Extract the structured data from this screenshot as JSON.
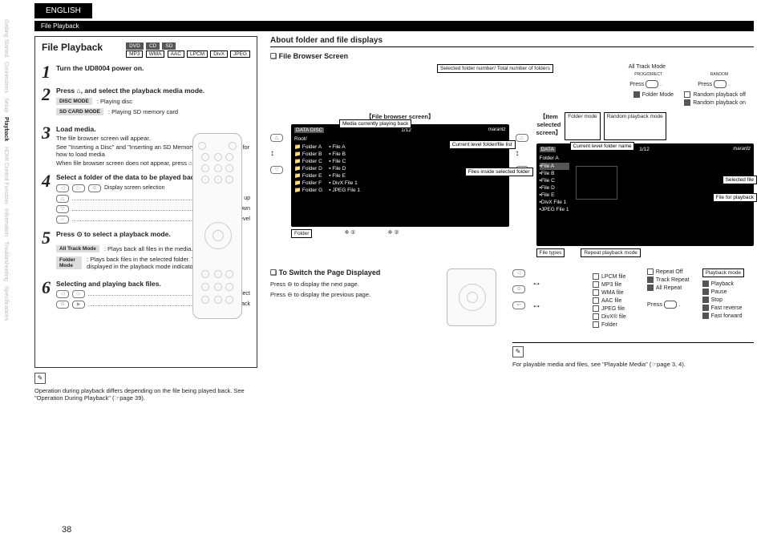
{
  "language_tab": "ENGLISH",
  "section_header": "File Playback",
  "sidenav": [
    "Getting Started",
    "Connections",
    "Setup",
    "Playback",
    "HDMI Control Function",
    "Information",
    "Troubleshooting",
    "Specifications"
  ],
  "sidenav_active": 3,
  "left": {
    "title": "File Playback",
    "badges_dark": [
      "DVD",
      "CD",
      "SD"
    ],
    "badges_light": [
      "MP3",
      "WMA",
      "AAC",
      "LPCM",
      "DivX",
      "JPEG"
    ],
    "step1_title": "Turn the UD8004 power on.",
    "step2_title": "Press ⌂, and select the playback media mode.",
    "disc_mode_label": "DISC MODE",
    "disc_mode_text": ": Playing disc",
    "sd_mode_label": "SD CARD MODE",
    "sd_mode_text": ": Playing SD memory card",
    "step3_title": "Load media.",
    "step3_a": "The file browser screen will appear.",
    "step3_b": "See \"Inserting a Disc\" and \"Inserting an SD Memory Card\" (☞page 6) for how to load media",
    "step3_c": "When file browser screen does not appear, press ⌂.",
    "step4_title": "Select a folder of the data to be played back and press ⊙.",
    "step4_legend0": "Display screen selection",
    "step4_legend1": "To next level up",
    "step4_legend2": "To next level down",
    "step4_legend3": "To the top level",
    "step5_title": "Press ⊙ to select a playback mode.",
    "alltrack_label": "All Track Mode",
    "alltrack_text": ": Plays back all files in the media.",
    "folder_label": "Folder Mode",
    "folder_text": ": Plays back files in the selected folder. The folder icon is displayed in the playback mode indicator.",
    "step6_title": "Selecting and playing back files.",
    "step6_legend1": "Select",
    "step6_legend2": "Decision or playback",
    "footnote": "Operation during playback differs depending on the file being played back. See \"Operation During Playback\" (☞page 39)."
  },
  "right": {
    "h3": "About folder and file displays",
    "h4a": "❏ File Browser Screen",
    "alltrack_mode": "All Track Mode",
    "prog_direct": "PROG/DIRECT",
    "random": "RANDOM",
    "press": "Press",
    "folder_mode": "Folder Mode",
    "rand_off": "Random playback off",
    "rand_on": "Random playback on",
    "fold_mode": "Folder mode",
    "rand_mode": "Random playback mode",
    "c_selected": "Selected folder number/ Total number of folders",
    "c_current_media": "Media currently playing back",
    "c_current_level": "Current level folder/file list",
    "c_files_inside": "Files inside selected folder",
    "c_current_name": "Current level folder name",
    "c_selected_file": "Selected file",
    "c_file_playback": "File for playback",
    "c_repeat_mode": "Repeat playback mode",
    "c_playback_mode": "Playback mode",
    "c_file_types": "File types",
    "c_folder": "Folder",
    "label_browser": "【File browser screen】",
    "label_item": "【Item selected screen】",
    "screen1_title": "DATA DISC",
    "screen1_counter": "1/12",
    "brand": "marantz",
    "root": "Root/",
    "folders": [
      "Folder A",
      "Folder B",
      "Folder C",
      "Folder D",
      "Folder E",
      "Folder F",
      "Folder G"
    ],
    "files": [
      "File A",
      "File B",
      "File C",
      "File D",
      "File E",
      "DivX File 1",
      "JPEG File 1"
    ],
    "screen2_title": "DATA",
    "folderA": "Folder A",
    "mark1": "※ ①",
    "mark2": "※ ②",
    "types_label": "File types",
    "types": [
      "LPCM file",
      "MP3 file",
      "WMA file",
      "AAC file",
      "JPEG file",
      "DivX® file",
      "Folder"
    ],
    "repeat": [
      "Repeat Off",
      "Track Repeat",
      "All Repeat"
    ],
    "playback": [
      "Playback",
      "Pause",
      "Stop",
      "Fast reverse",
      "Fast forward"
    ],
    "h4b": "❏ To Switch the Page Displayed",
    "switch1": "Press ⊖ to display the next page.",
    "switch2": "Press ⊖ to display the previous page.",
    "note_bottom": "For playable media and files, see \"Playable Media\" (☞page 3, 4)."
  },
  "page_number": "38"
}
